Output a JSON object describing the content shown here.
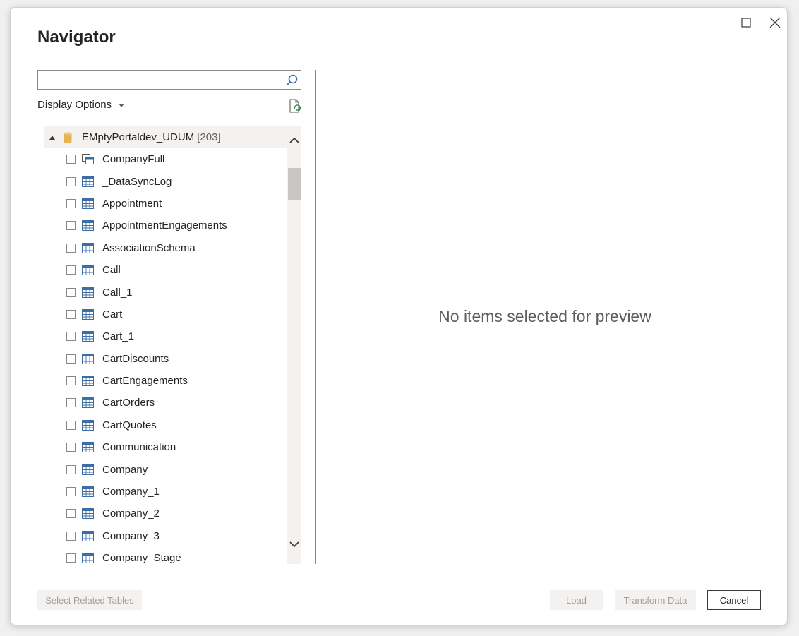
{
  "window": {
    "title": "Navigator"
  },
  "search": {
    "value": "",
    "placeholder": ""
  },
  "display_options": {
    "label": "Display Options"
  },
  "tree": {
    "root": {
      "label": "EMptyPortaldev_UDUM",
      "count": "[203]",
      "expanded": true
    },
    "items": [
      {
        "label": "CompanyFull",
        "icon": "view-icon",
        "checked": false
      },
      {
        "label": "_DataSyncLog",
        "icon": "table-icon",
        "checked": false
      },
      {
        "label": "Appointment",
        "icon": "table-icon",
        "checked": false
      },
      {
        "label": "AppointmentEngagements",
        "icon": "table-icon",
        "checked": false
      },
      {
        "label": "AssociationSchema",
        "icon": "table-icon",
        "checked": false
      },
      {
        "label": "Call",
        "icon": "table-icon",
        "checked": false
      },
      {
        "label": "Call_1",
        "icon": "table-icon",
        "checked": false
      },
      {
        "label": "Cart",
        "icon": "table-icon",
        "checked": false
      },
      {
        "label": "Cart_1",
        "icon": "table-icon",
        "checked": false
      },
      {
        "label": "CartDiscounts",
        "icon": "table-icon",
        "checked": false
      },
      {
        "label": "CartEngagements",
        "icon": "table-icon",
        "checked": false
      },
      {
        "label": "CartOrders",
        "icon": "table-icon",
        "checked": false
      },
      {
        "label": "CartQuotes",
        "icon": "table-icon",
        "checked": false
      },
      {
        "label": "Communication",
        "icon": "table-icon",
        "checked": false
      },
      {
        "label": "Company",
        "icon": "table-icon",
        "checked": false
      },
      {
        "label": "Company_1",
        "icon": "table-icon",
        "checked": false
      },
      {
        "label": "Company_2",
        "icon": "table-icon",
        "checked": false
      },
      {
        "label": "Company_3",
        "icon": "table-icon",
        "checked": false
      },
      {
        "label": "Company_Stage",
        "icon": "table-icon",
        "checked": false
      }
    ]
  },
  "preview": {
    "message": "No items selected for preview"
  },
  "buttons": {
    "select_related": "Select Related Tables",
    "load": "Load",
    "transform": "Transform Data",
    "cancel": "Cancel"
  },
  "colors": {
    "table_icon": "#3a6ea5",
    "db_icon": "#e8b451",
    "accent": "#3b3a39"
  }
}
